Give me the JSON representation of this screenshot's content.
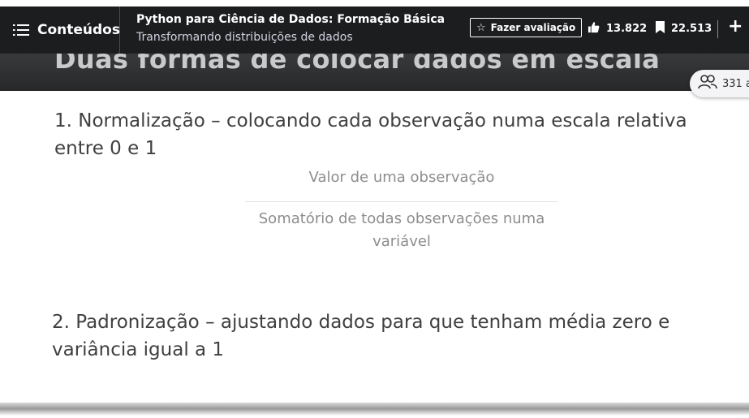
{
  "header": {
    "contents_label": "Conteúdos",
    "course_title": "Python para Ciência de Dados: Formação Básica",
    "lecture_subtitle": "Transformando distribuições de dados",
    "rate_label": "Fazer avaliação",
    "likes": "13.822",
    "bookmarks": "22.513"
  },
  "viewers": {
    "count": "331 a"
  },
  "slide": {
    "title": "Duas formas de colocar dados em escala",
    "point1": "1. Normalização – colocando cada observação numa escala relativa entre 0 e 1",
    "fraction_numerator": "Valor de uma observação",
    "fraction_denominator": "Somatório de todas observações numa variável",
    "point2": "2. Padronização – ajustando dados para que tenham média zero e variância igual a 1"
  }
}
